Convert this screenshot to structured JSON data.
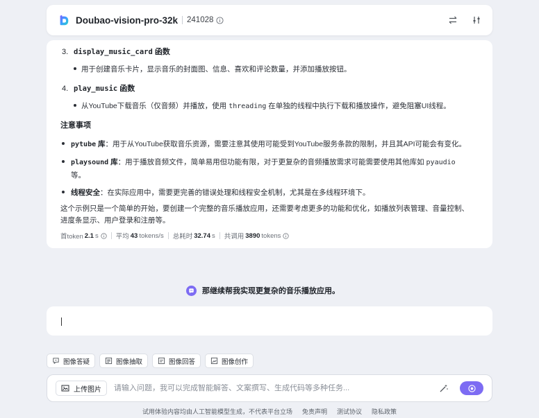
{
  "header": {
    "model_name": "Doubao-vision-pro-32k",
    "model_version": "241028"
  },
  "answer": {
    "items": [
      {
        "num": "3.",
        "func": "display_music_card",
        "suffix": " 函数",
        "desc": "用于创建音乐卡片，显示音乐的封面图、信息、喜欢和评论数量，并添加播放按钮。"
      },
      {
        "num": "4.",
        "func": "play_music",
        "suffix": " 函数",
        "desc_pre": "从YouTube下载音乐（仅音频）并播放，使用 ",
        "desc_code": "threading",
        "desc_post": " 在单独的线程中执行下载和播放操作，避免阻塞UI线程。"
      }
    ],
    "notes_title": "注意事项",
    "notes": [
      {
        "code": "pytube",
        "label": " 库",
        "text": "：用于从YouTube获取音乐资源，需要注意其使用可能受到YouTube服务条款的限制，并且其API可能会有变化。"
      },
      {
        "code": "playsound",
        "label": " 库",
        "text_line1": "：用于播放音频文件，简单易用但功能有限，对于更复杂的音频播放需求可能需要使用其他库如 ",
        "text_code": "pyaudio",
        "text_line2": "等。"
      },
      {
        "label": "线程安全",
        "text": "：在实际应用中，需要更完善的错误处理和线程安全机制，尤其是在多线程环境下。"
      }
    ],
    "summary_line1": "这个示例只是一个简单的开始，要创建一个完整的音乐播放应用，还需要考虑更多的功能和优化，如播放列表管理、音量控制、",
    "summary_line2": "进度条显示、用户登录和注册等。",
    "stats": {
      "first_token_label": "首token",
      "first_token_value": "2.1",
      "first_token_unit": "s",
      "avg_label": "平均",
      "avg_value": "43",
      "avg_unit": "tokens/s",
      "total_label": "总耗时",
      "total_value": "32.74",
      "total_unit": "s",
      "calls_label": "共调用",
      "calls_value": "3890",
      "calls_unit": "tokens"
    }
  },
  "user_message": "那继续帮我实现更复杂的音乐播放应用。",
  "tools": [
    {
      "icon": "question-image-icon",
      "label": "图像答疑"
    },
    {
      "icon": "extract-image-icon",
      "label": "图像抽取"
    },
    {
      "icon": "answer-image-icon",
      "label": "图像回答"
    },
    {
      "icon": "create-image-icon",
      "label": "图像创作"
    }
  ],
  "input": {
    "upload_label": "上传图片",
    "placeholder": "请输入问题，我可以完成智能解答、文案撰写、生成代码等多种任务..."
  },
  "footer": {
    "disclaimer": "试用体验内容均由人工智能模型生成，不代表平台立场",
    "link1": "免责声明",
    "link2": "测试协议",
    "link3": "隐私政策"
  },
  "colors": {
    "accent": "#7d6cf3",
    "background": "#eef0f5"
  }
}
